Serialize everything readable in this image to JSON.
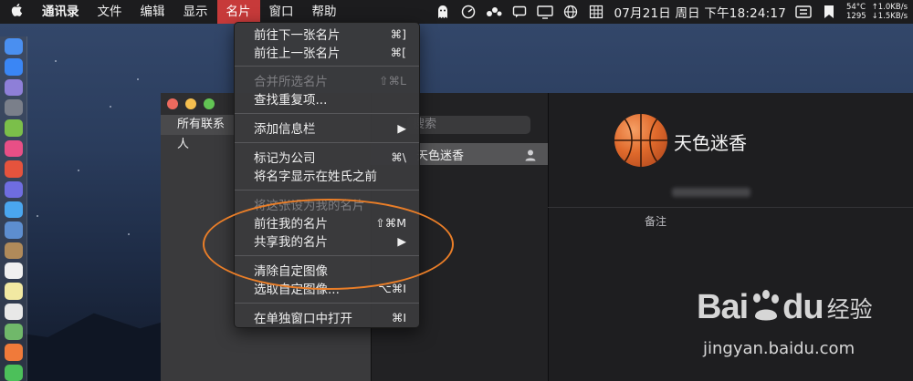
{
  "menubar": {
    "app_name": "通讯录",
    "menus": [
      {
        "label": "文件"
      },
      {
        "label": "编辑"
      },
      {
        "label": "显示"
      },
      {
        "label": "名片"
      },
      {
        "label": "窗口"
      },
      {
        "label": "帮助"
      }
    ],
    "clock": "07月21日 周日 下午18:24:17",
    "sys_temp": "54°C",
    "sys_rpm": "1295",
    "net_up": "↑1.0KB/s",
    "net_down": "↓1.5KB/s"
  },
  "dropdown": {
    "items": [
      {
        "label": "前往下一张名片",
        "shortcut": "⌘]",
        "disabled": false
      },
      {
        "label": "前往上一张名片",
        "shortcut": "⌘[",
        "disabled": false
      },
      {
        "label": "合并所选名片",
        "shortcut": "⇧⌘L",
        "disabled": true
      },
      {
        "label": "查找重复项...",
        "shortcut": "",
        "disabled": false
      },
      {
        "label": "添加信息栏",
        "shortcut": "▶",
        "disabled": false
      },
      {
        "label": "标记为公司",
        "shortcut": "⌘\\",
        "disabled": false
      },
      {
        "label": "将名字显示在姓氏之前",
        "shortcut": "",
        "disabled": false
      },
      {
        "label": "将这张设为我的名片",
        "shortcut": "",
        "disabled": true
      },
      {
        "label": "前往我的名片",
        "shortcut": "⇧⌘M",
        "disabled": false
      },
      {
        "label": "共享我的名片",
        "shortcut": "▶",
        "disabled": false
      },
      {
        "label": "清除自定图像",
        "shortcut": "",
        "disabled": false
      },
      {
        "label": "选取自定图像...",
        "shortcut": "⌥⌘I",
        "disabled": false
      },
      {
        "label": "在单独窗口中打开",
        "shortcut": "⌘I",
        "disabled": false
      }
    ]
  },
  "contacts_window": {
    "groups_header": "所有联系人",
    "search_placeholder": "搜索",
    "selected_contact": "天色迷香",
    "detail_name": "天色迷香",
    "note_label": "备注"
  },
  "watermark": {
    "brand_latin": "Bai",
    "brand_latin2": "du",
    "brand_cn": "经验",
    "url": "jingyan.baidu.com"
  },
  "colors": {
    "menu_active": "#c73a3a",
    "annotation": "#ea7e28"
  }
}
